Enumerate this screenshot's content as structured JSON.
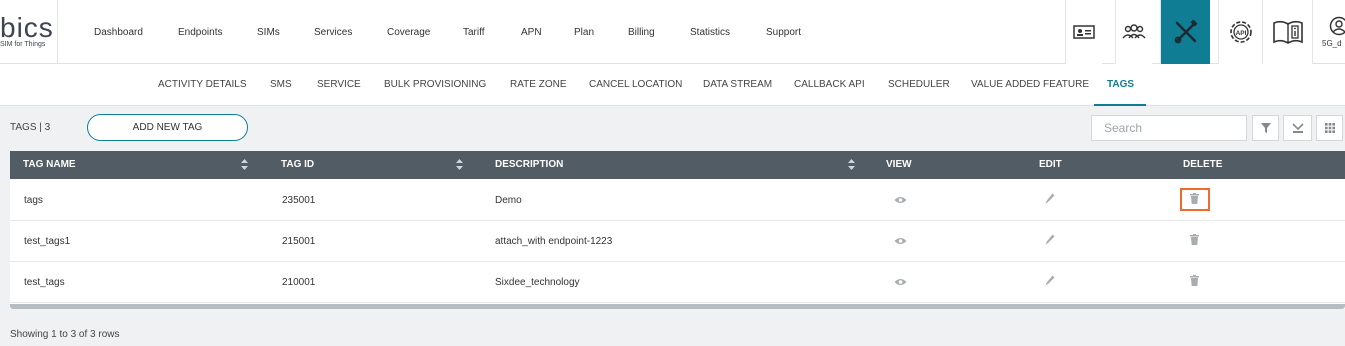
{
  "brand": {
    "logo_text": "bics",
    "logo_sub": "SIM for Things",
    "accent": "#0f7d93"
  },
  "nav": {
    "items": [
      {
        "label": "Dashboard"
      },
      {
        "label": "Endpoints"
      },
      {
        "label": "SIMs"
      },
      {
        "label": "Services"
      },
      {
        "label": "Coverage"
      },
      {
        "label": "Tariff"
      },
      {
        "label": "APN"
      },
      {
        "label": "Plan"
      },
      {
        "label": "Billing"
      },
      {
        "label": "Statistics"
      },
      {
        "label": "Support"
      }
    ],
    "icons": [
      "contact-card-icon",
      "users-group-icon",
      "tools-icon",
      "api-gear-icon",
      "manual-book-icon"
    ],
    "user_label": "5G_d"
  },
  "subtabs": {
    "items": [
      {
        "label": "ACTIVITY DETAILS"
      },
      {
        "label": "SMS"
      },
      {
        "label": "SERVICE"
      },
      {
        "label": "BULK PROVISIONING"
      },
      {
        "label": "RATE ZONE"
      },
      {
        "label": "CANCEL LOCATION"
      },
      {
        "label": "DATA STREAM"
      },
      {
        "label": "CALLBACK API"
      },
      {
        "label": "SCHEDULER"
      },
      {
        "label": "VALUE ADDED FEATURE"
      },
      {
        "label": "TAGS"
      }
    ],
    "active": "TAGS"
  },
  "toolbar": {
    "tags_label": "TAGS |  3",
    "add_button": "ADD NEW TAG",
    "search_placeholder": "Search",
    "tools": [
      "filter-icon",
      "export-icon",
      "columns-grid-icon"
    ]
  },
  "table": {
    "headers": {
      "name": "TAG NAME",
      "id": "TAG ID",
      "description": "DESCRIPTION",
      "view": "VIEW",
      "edit": "EDIT",
      "delete": "DELETE"
    },
    "rows": [
      {
        "name": "tags",
        "id": "235001",
        "description": "Demo"
      },
      {
        "name": "test_tags1",
        "id": "215001",
        "description": "attach_with endpoint-1223"
      },
      {
        "name": "test_tags",
        "id": "210001",
        "description": "Sixdee_technology"
      }
    ],
    "highlight_color": "#f26a2e"
  },
  "footer": {
    "summary": "Showing 1 to 3 of 3 rows"
  }
}
